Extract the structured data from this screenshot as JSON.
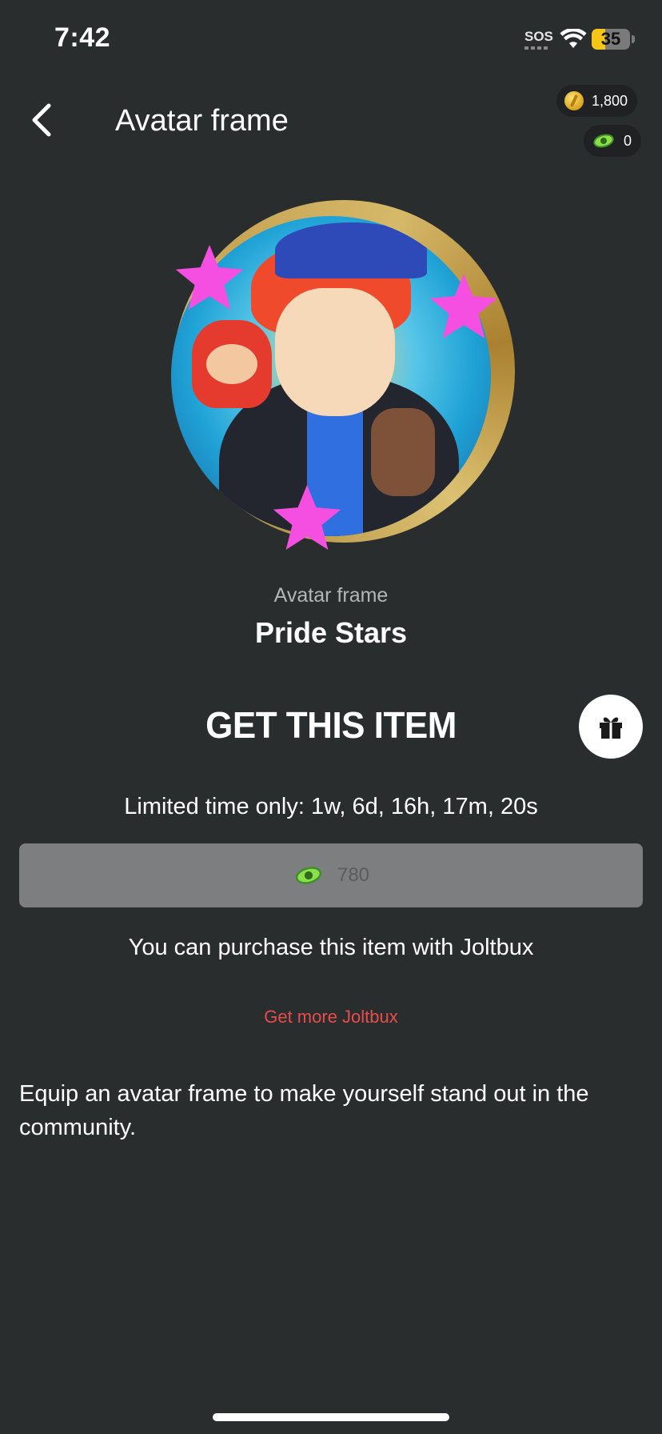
{
  "status_bar": {
    "time": "7:42",
    "sos": "SOS",
    "battery": "35",
    "battery_level": 0.35
  },
  "header": {
    "title": "Avatar frame",
    "coins": "1,800",
    "joltbux": "0"
  },
  "item": {
    "type": "Avatar frame",
    "name": "Pride Stars"
  },
  "purchase": {
    "title": "GET THIS ITEM",
    "timer": "Limited time only: 1w, 6d, 16h, 17m, 20s",
    "price": "780",
    "note": "You can purchase this item with Joltbux",
    "get_more": "Get more Joltbux"
  },
  "description": "Equip an avatar frame to make yourself stand out in the community.",
  "colors": {
    "background": "#2a2d2e",
    "accent_link": "#e84c4c",
    "star_pink": "#f54fe1",
    "battery_yellow": "#f5c518"
  },
  "icons": {
    "back": "chevron-left-icon",
    "coin": "coin-icon",
    "joltbux": "joltbux-icon",
    "gift": "gift-icon",
    "wifi": "wifi-icon"
  }
}
